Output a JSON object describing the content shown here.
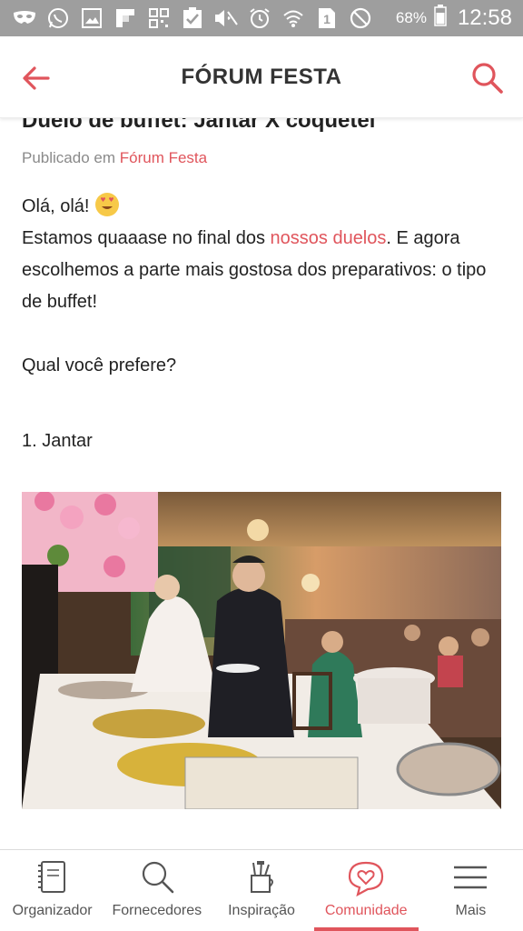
{
  "status_bar": {
    "icons": [
      "mask-icon",
      "whatsapp-icon",
      "gallery-icon",
      "flipboard-icon",
      "qr-icon",
      "clipboard-check-icon",
      "mute-icon",
      "alarm-icon",
      "wifi-icon",
      "sim-icon",
      "dnd-icon",
      "battery-icon"
    ],
    "battery": "68%",
    "time": "12:58"
  },
  "header": {
    "title": "FÓRUM FESTA",
    "back_icon": "arrow-left-icon",
    "search_icon": "search-icon",
    "accent": "#e0555c"
  },
  "post": {
    "title": "Duelo de buffet: Jantar X coquetel",
    "published_prefix": "Publicado em",
    "published_category": "Fórum Festa",
    "greeting": "Olá, olá!",
    "line1_before": "Estamos quaaase no final dos ",
    "line1_link": "nossos duelos",
    "line1_after": ". E agora escolhemos a parte mais gostosa dos preparativos: o tipo de buffet!",
    "question": "Qual você prefere?",
    "item1": "1. Jantar",
    "photo": "wedding-buffet-photo"
  },
  "bottom_nav": {
    "items": [
      {
        "label": "Organizador",
        "icon": "notebook-icon"
      },
      {
        "label": "Fornecedores",
        "icon": "search-icon"
      },
      {
        "label": "Inspiração",
        "icon": "pencil-cup-icon"
      },
      {
        "label": "Comunidade",
        "icon": "heart-chat-icon"
      },
      {
        "label": "Mais",
        "icon": "menu-icon"
      }
    ],
    "active": "Comunidade"
  }
}
